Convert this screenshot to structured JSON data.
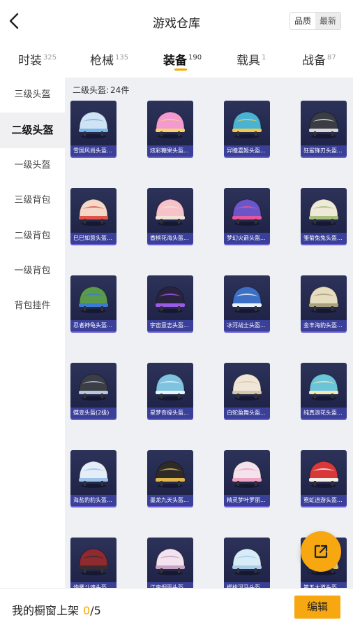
{
  "header": {
    "title": "游戏仓库",
    "sort": {
      "quality_label": "品质",
      "newest_label": "最新",
      "selected": "最新"
    }
  },
  "tabs": [
    {
      "label": "时装",
      "count": "325",
      "active": false
    },
    {
      "label": "枪械",
      "count": "135",
      "active": false
    },
    {
      "label": "装备",
      "count": "190",
      "active": true
    },
    {
      "label": "载具",
      "count": "1",
      "active": false
    },
    {
      "label": "战备",
      "count": "87",
      "active": false
    }
  ],
  "sidebar": {
    "items": [
      {
        "label": "三级头盔",
        "active": false
      },
      {
        "label": "二级头盔",
        "active": true
      },
      {
        "label": "一级头盔",
        "active": false
      },
      {
        "label": "三级背包",
        "active": false
      },
      {
        "label": "二级背包",
        "active": false
      },
      {
        "label": "一级背包",
        "active": false
      },
      {
        "label": "背包挂件",
        "active": false
      }
    ]
  },
  "content": {
    "count_label": "二级头盔:",
    "count_value": "24件",
    "items": [
      {
        "name": "雪国风尚头盔...",
        "color": "#cfe3f5",
        "accent": "#7ab6e8"
      },
      {
        "name": "炫彩糖果头盔...",
        "color": "#f49ad0",
        "accent": "#f6d36b"
      },
      {
        "name": "异瞳嘉姬头盔...",
        "color": "#49b3d6",
        "accent": "#f2c84b"
      },
      {
        "name": "狂鲨锋刃头盔...",
        "color": "#3a3d44",
        "accent": "#d8d8d8"
      },
      {
        "name": "巳巳如意头盔...",
        "color": "#f5d9c8",
        "accent": "#e1544a"
      },
      {
        "name": "香槟花海头盔...",
        "color": "#f7c2c9",
        "accent": "#f0e3d8"
      },
      {
        "name": "梦幻火箭头盔...",
        "color": "#6a56c9",
        "accent": "#e5569a"
      },
      {
        "name": "雏菊兔兔头盔...",
        "color": "#eee9d8",
        "accent": "#a7c07c"
      },
      {
        "name": "忍者神龟头盔...",
        "color": "#5a9a4a",
        "accent": "#3a7bd5"
      },
      {
        "name": "宇宙意志头盔...",
        "color": "#2a2340",
        "accent": "#9a5ae8"
      },
      {
        "name": "冰河战士头盔...",
        "color": "#3d6fc4",
        "accent": "#e8f2fb"
      },
      {
        "name": "金丰海豹头盔...",
        "color": "#e6dcc0",
        "accent": "#a9a27e"
      },
      {
        "name": "蝶变头盔(2级)",
        "color": "#3b3e46",
        "accent": "#b9c7d6"
      },
      {
        "name": "星梦奇缘头盔...",
        "color": "#7fc3e0",
        "accent": "#e5f4fb"
      },
      {
        "name": "白蛇盈舞头盔...",
        "color": "#efe6d7",
        "accent": "#d8c6a8"
      },
      {
        "name": "纯真浪花头盔...",
        "color": "#6cc4d9",
        "accent": "#f5e8b5"
      },
      {
        "name": "海盐豹豹头盔...",
        "color": "#e3eef9",
        "accent": "#9cc1ea"
      },
      {
        "name": "墨龙九天头盔...",
        "color": "#2d2a28",
        "accent": "#e2b54a"
      },
      {
        "name": "精灵梦叶罗丽...",
        "color": "#f4e3ea",
        "accent": "#f2a5c3"
      },
      {
        "name": "霓虹逍游头盔...",
        "color": "#d8383a",
        "accent": "#f6f0e8"
      },
      {
        "name": "炮鹰斗魂头盔...",
        "color": "#8e2a30",
        "accent": "#3a2c2e"
      },
      {
        "name": "江南烟雨头盔...",
        "color": "#f3e3ef",
        "accent": "#c9a3c5"
      },
      {
        "name": "樱桃河马头盔...",
        "color": "#d8ecf7",
        "accent": "#a9cde9"
      },
      {
        "name": "第五大道头盔...",
        "color": "#e7ecf3",
        "accent": "#f3d46a"
      }
    ]
  },
  "fab": {
    "icon": "share-export-icon"
  },
  "footer": {
    "label": "我的橱窗上架",
    "current": "0",
    "total": "/5",
    "edit_label": "编辑"
  },
  "colors": {
    "accent": "#f7a70f",
    "card_bg": "#2d3259",
    "card_label_bg": "#3a3f98"
  }
}
